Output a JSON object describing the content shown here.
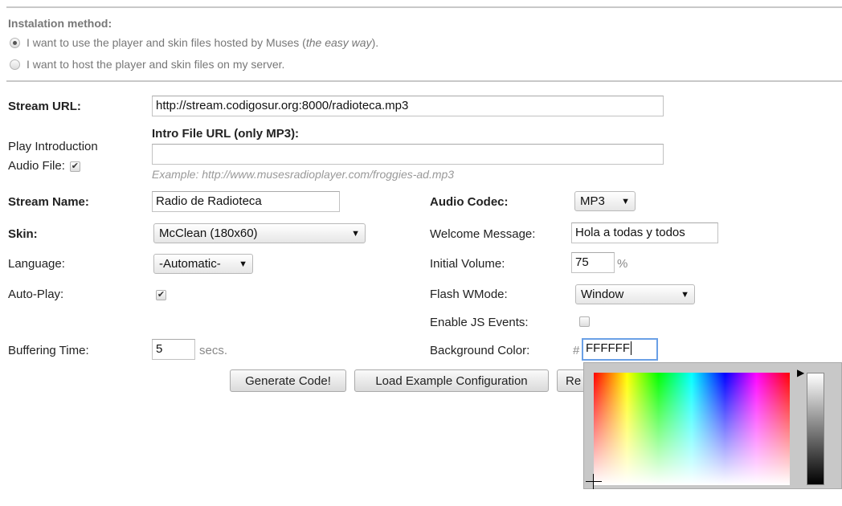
{
  "install": {
    "title": "Instalation method:",
    "option_easy_prefix": "I want to use the player and skin files hosted by Muses (",
    "option_easy_em": "the easy way",
    "option_easy_suffix": ").",
    "option_own": "I want to host the player and skin files on my server."
  },
  "form": {
    "stream_url_label": "Stream URL:",
    "stream_url_value": "http://stream.codigosur.org:8000/radioteca.mp3",
    "play_intro_label_line1": "Play Introduction",
    "play_intro_label_line2": "Audio File:",
    "intro_url_label": "Intro File URL (only MP3):",
    "intro_url_value": "",
    "intro_example": "Example: http://www.musesradioplayer.com/froggies-ad.mp3",
    "stream_name_label": "Stream Name:",
    "stream_name_value": "Radio de Radioteca",
    "audio_codec_label": "Audio Codec:",
    "audio_codec_value": "MP3",
    "skin_label": "Skin:",
    "skin_value": "McClean (180x60)",
    "welcome_label": "Welcome Message:",
    "welcome_value": "Hola a todas y todos",
    "language_label": "Language:",
    "language_value": "-Automatic-",
    "initial_volume_label": "Initial Volume:",
    "initial_volume_value": "75",
    "percent": "%",
    "autoplay_label": "Auto-Play:",
    "wmode_label": "Flash WMode:",
    "wmode_value": "Window",
    "js_events_label": "Enable JS Events:",
    "buffering_label": "Buffering Time:",
    "buffering_value": "5",
    "secs": "secs.",
    "bgcolor_label": "Background Color:",
    "hash": "#",
    "bgcolor_value": "FFFFFF"
  },
  "buttons": {
    "generate": "Generate Code!",
    "load_example": "Load Example Configuration",
    "reset_partial": "Re"
  },
  "icons": {
    "check": "✔",
    "dropdown": "▼",
    "picker_pointer": "▶",
    "crosshair": "+"
  },
  "colors": {
    "focus_border": "#6aa0e6",
    "picker_bg": "#c8c8c8"
  }
}
